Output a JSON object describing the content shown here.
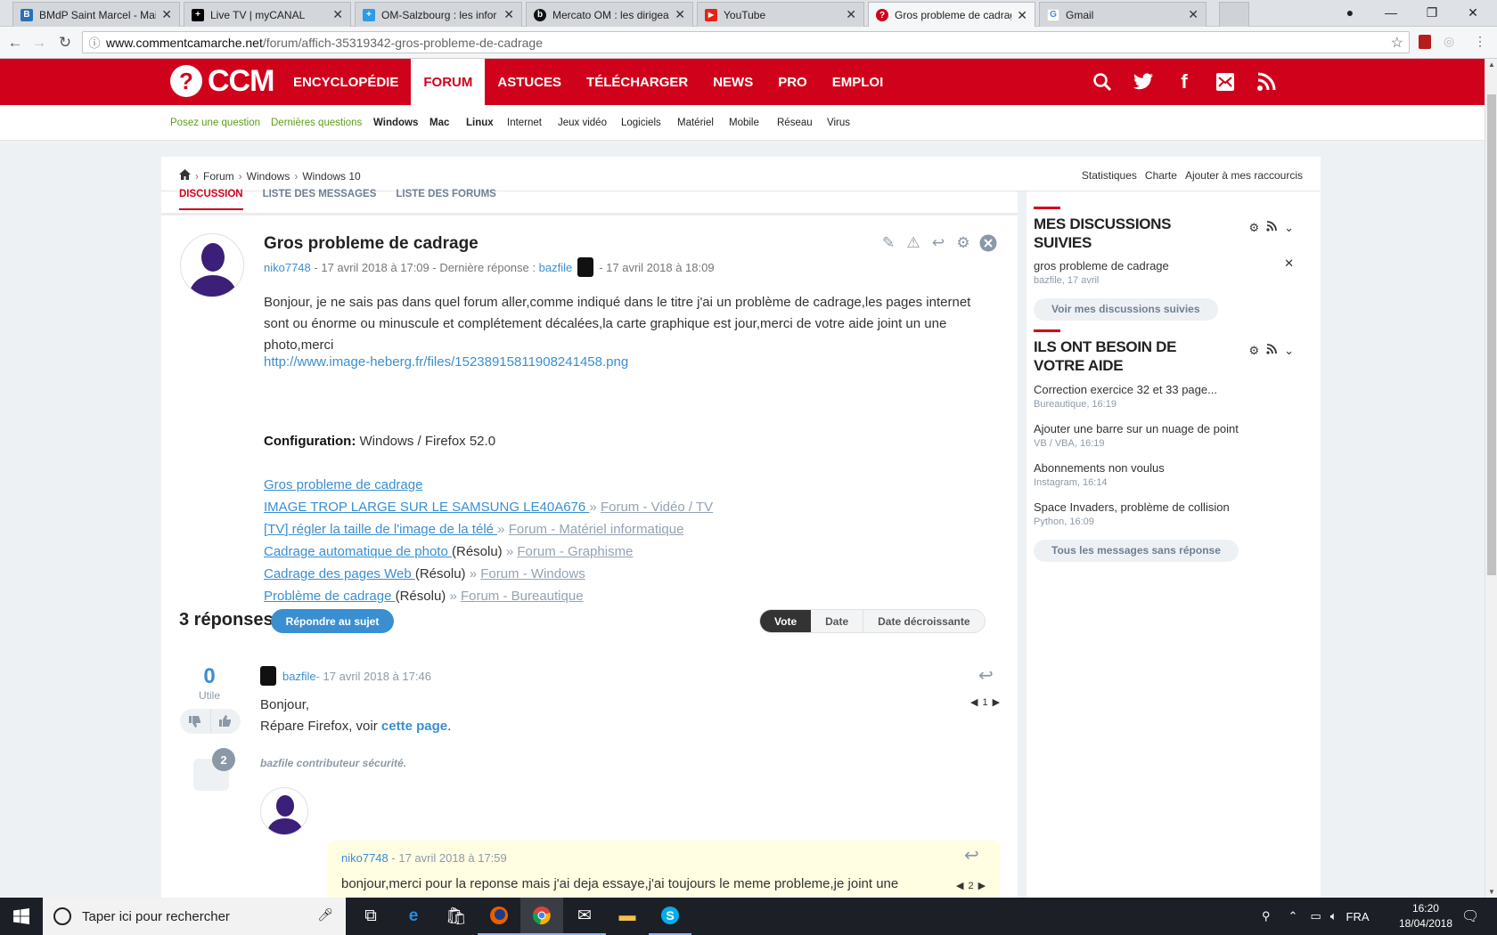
{
  "browser": {
    "tabs": [
      {
        "title": "BMdP Saint Marcel - Mai",
        "color": "#2a6fb5",
        "glyph": "B"
      },
      {
        "title": "Live TV | myCANAL",
        "color": "#000000",
        "glyph": "+"
      },
      {
        "title": "OM-Salzbourg : les infor",
        "color": "#2e9be6",
        "glyph": "+"
      },
      {
        "title": "Mercato OM : les dirigea",
        "color": "#111111",
        "glyph": "b"
      },
      {
        "title": "YouTube",
        "color": "#e62117",
        "glyph": "▶"
      },
      {
        "title": "Gros probleme de cadrag",
        "color": "#d0021b",
        "glyph": "?"
      },
      {
        "title": "Gmail",
        "color": "#ffffff",
        "glyph": "G"
      }
    ],
    "url_host": "www.commentcamarche.net",
    "url_path": "/forum/affich-35319342-gros-probleme-de-cadrage"
  },
  "site": {
    "logo": "CCM",
    "nav": [
      "ENCYCLOPÉDIE",
      "FORUM",
      "ASTUCES",
      "TÉLÉCHARGER",
      "NEWS",
      "PRO",
      "EMPLOI"
    ],
    "subnav": [
      "Posez une question",
      "Dernières questions",
      "Windows",
      "Mac",
      "Linux",
      "Internet",
      "Jeux vidéo",
      "Logiciels",
      "Matériel",
      "Mobile",
      "Réseau",
      "Virus"
    ]
  },
  "breadcrumb": [
    "Forum",
    "Windows",
    "Windows 10"
  ],
  "toplinks": [
    "Statistiques",
    "Charte",
    "Ajouter à mes raccourcis"
  ],
  "tabs": [
    "DISCUSSION",
    "LISTE DES MESSAGES",
    "LISTE DES FORUMS"
  ],
  "post": {
    "title": "Gros probleme de cadrage",
    "author": "niko7748",
    "date": "- 17 avril 2018 à 17:09 - Dernière réponse :",
    "last_user": "bazfile",
    "last_date": "- 17 avril 2018 à 18:09",
    "body": "Bonjour, je ne sais pas dans quel forum aller,comme indiqué dans le titre j'ai un problème de cadrage,les pages internet sont ou énorme ou minuscule et complétement décalées,la carte graphique est jour,merci de votre aide joint un une photo,merci",
    "link": "http://www.image-heberg.fr/files/15238915811908241458.png",
    "config_label": "Configuration:",
    "config_value": " Windows / Firefox 52.0"
  },
  "related": [
    {
      "title": "Gros probleme de cadrage",
      "status": "",
      "sep": "",
      "forum": ""
    },
    {
      "title": "IMAGE TROP LARGE SUR LE SAMSUNG LE40A676 ",
      "status": "",
      "sep": "» ",
      "forum": "Forum - Vidéo / TV"
    },
    {
      "title": "[TV] régler la taille de l'image de la télé ",
      "status": "",
      "sep": "» ",
      "forum": "Forum - Matériel informatique"
    },
    {
      "title": "Cadrage automatique de photo ",
      "status": "(Résolu) ",
      "sep": "» ",
      "forum": "Forum - Graphisme"
    },
    {
      "title": "Cadrage des pages Web ",
      "status": "(Résolu) ",
      "sep": "» ",
      "forum": "Forum - Windows"
    },
    {
      "title": "Problème de cadrage ",
      "status": "(Résolu) ",
      "sep": "» ",
      "forum": "Forum - Bureautique"
    }
  ],
  "replies": {
    "count_label": "3 réponses",
    "reply_button": "Répondre au sujet",
    "sort": [
      "Vote",
      "Date",
      "Date décroissante"
    ]
  },
  "answer": {
    "votes": "0",
    "votes_label": "Utile",
    "comments": "2",
    "author": "bazfile",
    "date": " - 17 avril 2018 à 17:46",
    "line1": "Bonjour,",
    "line2": "Répare Firefox, voir ",
    "link": "cette page",
    "end": ".",
    "signature": "bazfile contributeur sécurité.",
    "pager": "1"
  },
  "nested": {
    "author": "niko7748",
    "date": " - 17 avril 2018 à 17:59",
    "body": "bonjour,merci pour la reponse mais j'ai deja essaye,j'ai toujours le meme probleme,je joint une",
    "pager": "2"
  },
  "sidebar": {
    "followed_title": "MES DISCUSSIONS SUIVIES",
    "followed_item": {
      "title": "gros probleme de cadrage",
      "meta": "bazfile, 17 avril"
    },
    "followed_button": "Voir mes discussions suivies",
    "help_title": "ILS ONT BESOIN DE VOTRE AIDE",
    "help_items": [
      {
        "title": "Correction exercice 32 et 33 page...",
        "meta": "Bureautique, 16:19"
      },
      {
        "title": "Ajouter une barre sur un nuage de point",
        "meta": "VB / VBA, 16:19"
      },
      {
        "title": "Abonnements non voulus",
        "meta": "Instagram, 16:14"
      },
      {
        "title": "Space Invaders, problème de collision",
        "meta": "Python, 16:09"
      }
    ],
    "help_button": "Tous les messages sans réponse"
  },
  "taskbar": {
    "search": "Taper ici pour rechercher",
    "lang": "FRA",
    "time": "16:20",
    "date": "18/04/2018"
  }
}
